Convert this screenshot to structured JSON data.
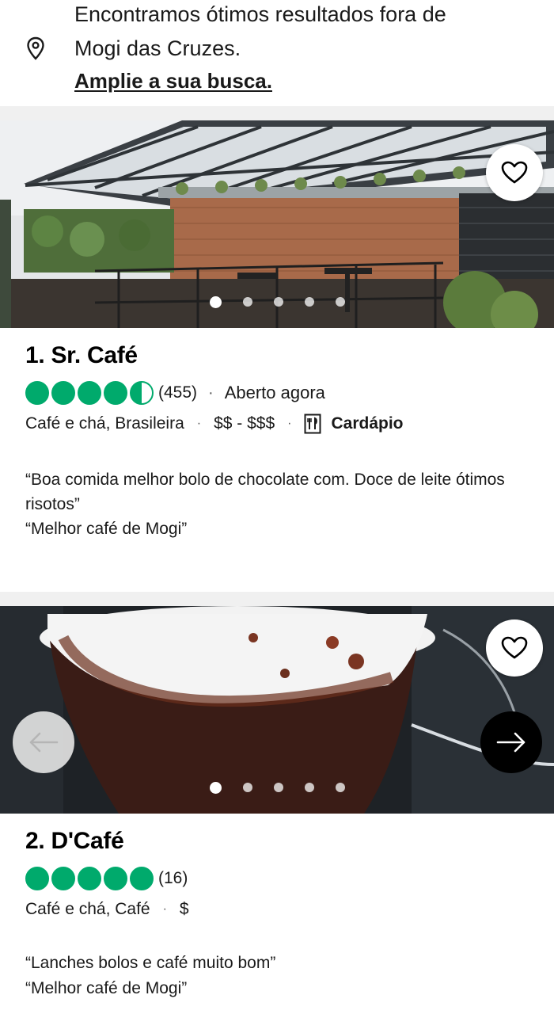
{
  "banner": {
    "line1": "Encontramos ótimos resultados fora de",
    "line2": "Mogi das Cruzes.",
    "link": "Amplie a sua busca.",
    "icon": "location-pin-icon"
  },
  "results": [
    {
      "title": "1. Sr. Café",
      "rating": 4.5,
      "review_count": "(455)",
      "status": "Aberto agora",
      "cuisine": "Café e chá, Brasileira",
      "price": "$$ - $$$",
      "menu_label": "Cardápio",
      "reviews": [
        "“Boa comida melhor bolo de chocolate com. Doce de leite ótimos risotos”",
        "“Melhor café de Mogi”"
      ],
      "photo_count": 5,
      "active_photo": 1
    },
    {
      "title": "2. D'Café",
      "rating": 5,
      "review_count": "(16)",
      "cuisine": "Café e chá, Café",
      "price": "$",
      "reviews": [
        "“Lanches bolos e café muito bom”",
        "“Melhor café de Mogi”"
      ],
      "photo_count": 5,
      "active_photo": 1
    }
  ],
  "colors": {
    "rating_green": "#00aa6c",
    "separator": "#f0f0f0",
    "next_button": "#000000"
  }
}
